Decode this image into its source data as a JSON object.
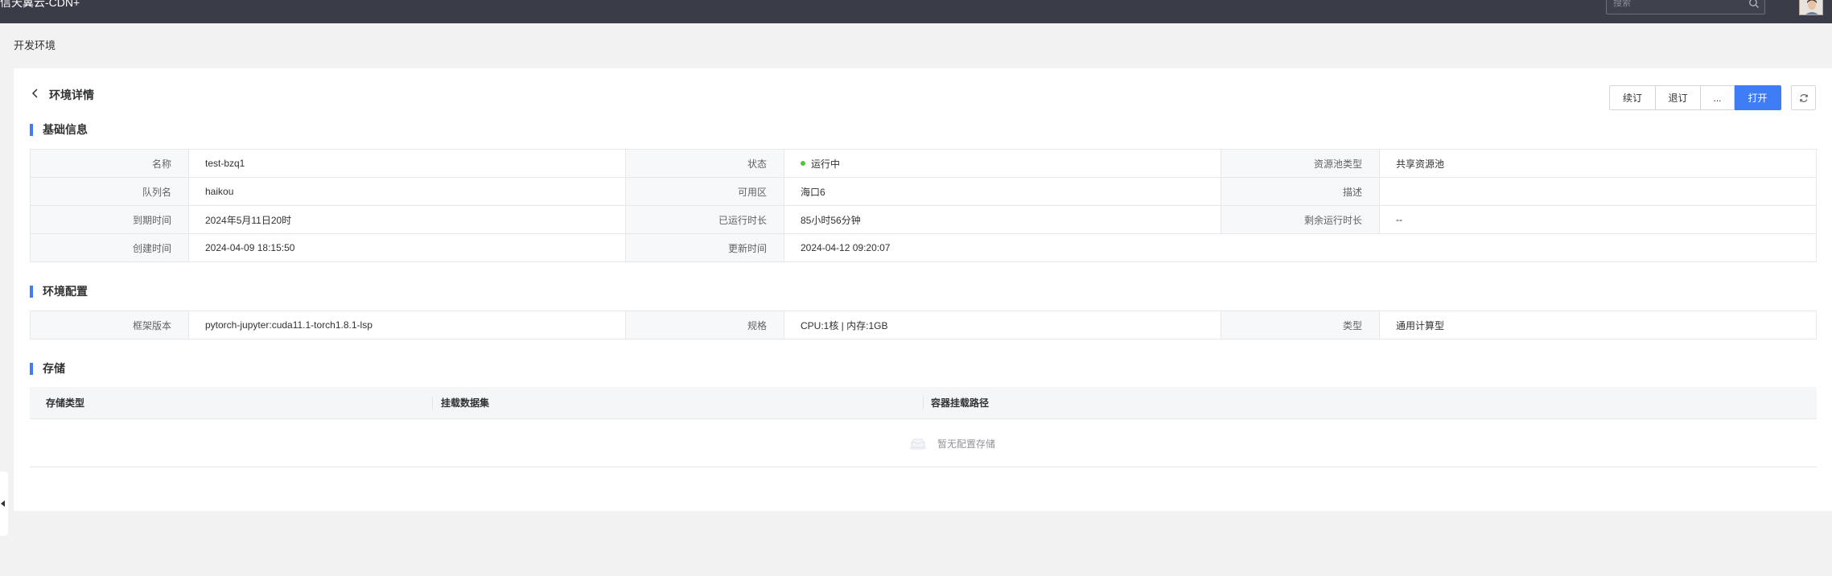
{
  "topbar": {
    "brand": "信天翼云-CDN+",
    "search_placeholder": "搜索"
  },
  "page": {
    "title": "开发环境"
  },
  "detail": {
    "title": "环境详情",
    "buttons": {
      "renew": "续订",
      "unsubscribe": "退订",
      "more": "...",
      "open": "打开"
    }
  },
  "basic": {
    "section_title": "基础信息",
    "rows": [
      [
        {
          "label": "名称",
          "value": "test-bzq1"
        },
        {
          "label": "状态",
          "value": "运行中"
        },
        {
          "label": "资源池类型",
          "value": "共享资源池"
        }
      ],
      [
        {
          "label": "队列名",
          "value": "haikou"
        },
        {
          "label": "可用区",
          "value": "海口6"
        },
        {
          "label": "描述",
          "value": ""
        }
      ],
      [
        {
          "label": "到期时间",
          "value": "2024年5月11日20时"
        },
        {
          "label": "已运行时长",
          "value": "85小时56分钟"
        },
        {
          "label": "剩余运行时长",
          "value": "--"
        }
      ],
      [
        {
          "label": "创建时间",
          "value": "2024-04-09 18:15:50"
        },
        {
          "label": "更新时间",
          "value": "2024-04-12 09:20:07"
        }
      ]
    ],
    "status_color": "#46c93a"
  },
  "config": {
    "section_title": "环境配置",
    "items": [
      {
        "label": "框架版本",
        "value": "pytorch-jupyter:cuda11.1-torch1.8.1-lsp"
      },
      {
        "label": "规格",
        "value": "CPU:1核 | 内存:1GB"
      },
      {
        "label": "类型",
        "value": "通用计算型"
      }
    ]
  },
  "storage": {
    "section_title": "存储",
    "columns": [
      "存储类型",
      "挂载数据集",
      "容器挂载路径"
    ],
    "empty_text": "暂无配置存储"
  },
  "colors": {
    "topbar": "#3a3d48",
    "primary": "#3e7df6",
    "page_bg": "#f2f2f3"
  }
}
